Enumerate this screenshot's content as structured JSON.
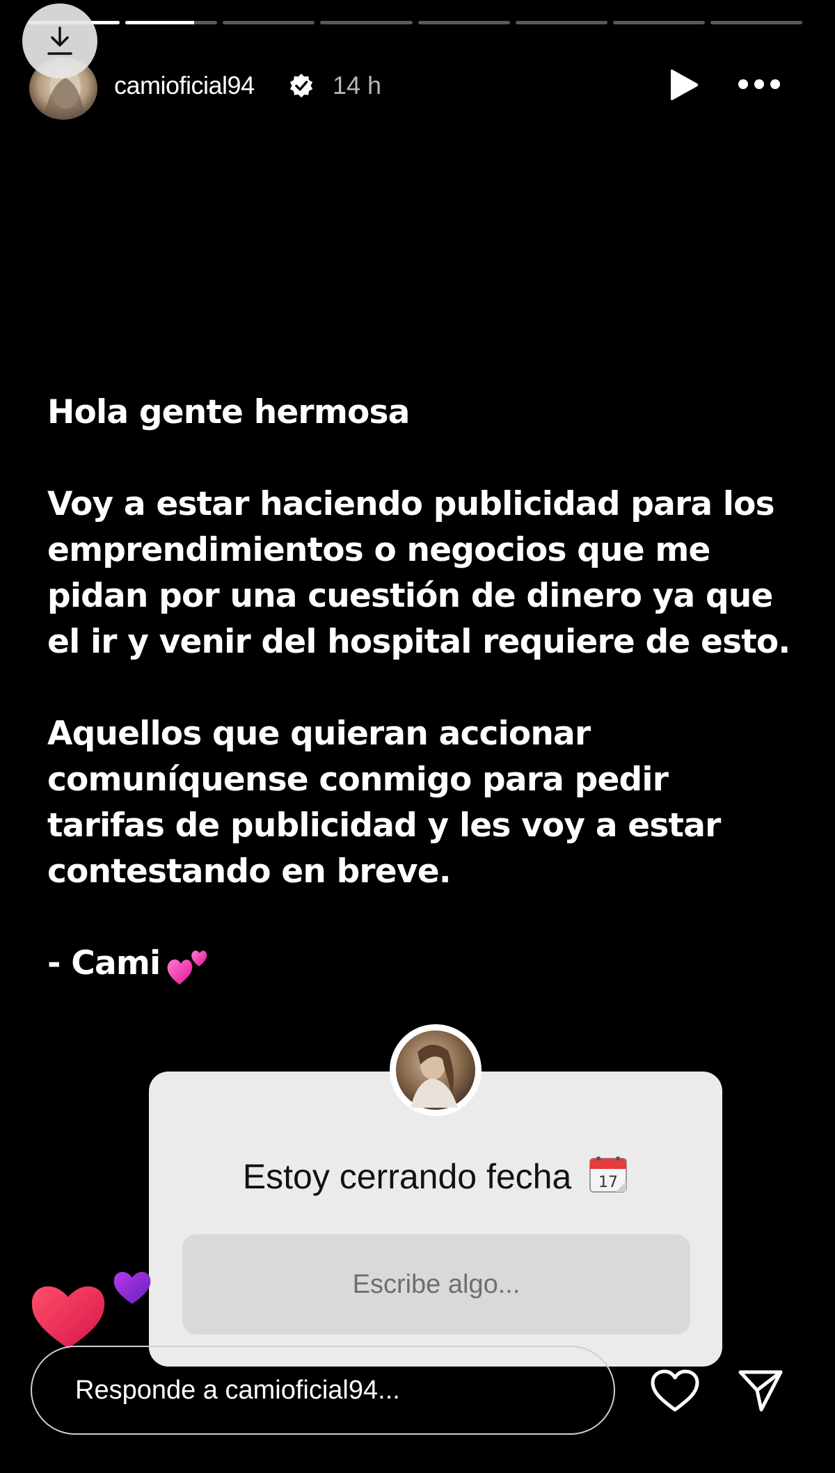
{
  "story": {
    "progress": [
      1.0,
      0.75,
      0,
      0,
      0,
      0,
      0,
      0
    ],
    "header": {
      "username": "camioficial94",
      "time": "14 h"
    },
    "text": {
      "greeting": "Hola gente hermosa",
      "paragraph1": [
        "Voy a estar haciendo publicidad para los",
        "emprendimientos o negocios que me",
        "pidan por una cuestión de dinero ya que",
        "el ir y venir del hospital requiere de esto."
      ],
      "paragraph2": [
        "Aquellos que quieran accionar",
        "comuníquense conmigo para pedir",
        "tarifas de publicidad y les voy a estar",
        "contestando en breve."
      ],
      "signature": "- Cami"
    },
    "sticker": {
      "question": "Estoy cerrando fecha",
      "input_placeholder": "Escribe algo..."
    }
  },
  "footer": {
    "reply_placeholder": "Responde a camioficial94..."
  },
  "icons": {
    "download": "download-icon",
    "verified": "verified-badge-icon",
    "play": "play-icon",
    "more": "more-options-icon",
    "like": "heart-outline-icon",
    "send": "paper-plane-icon",
    "calendar": "calendar-emoji",
    "two_hearts": "two-hearts-emoji"
  },
  "colors": {
    "background": "#000000",
    "verified": "#ffffff",
    "heart_red": "#e8244f",
    "heart_purple": "#8e2bd6"
  }
}
